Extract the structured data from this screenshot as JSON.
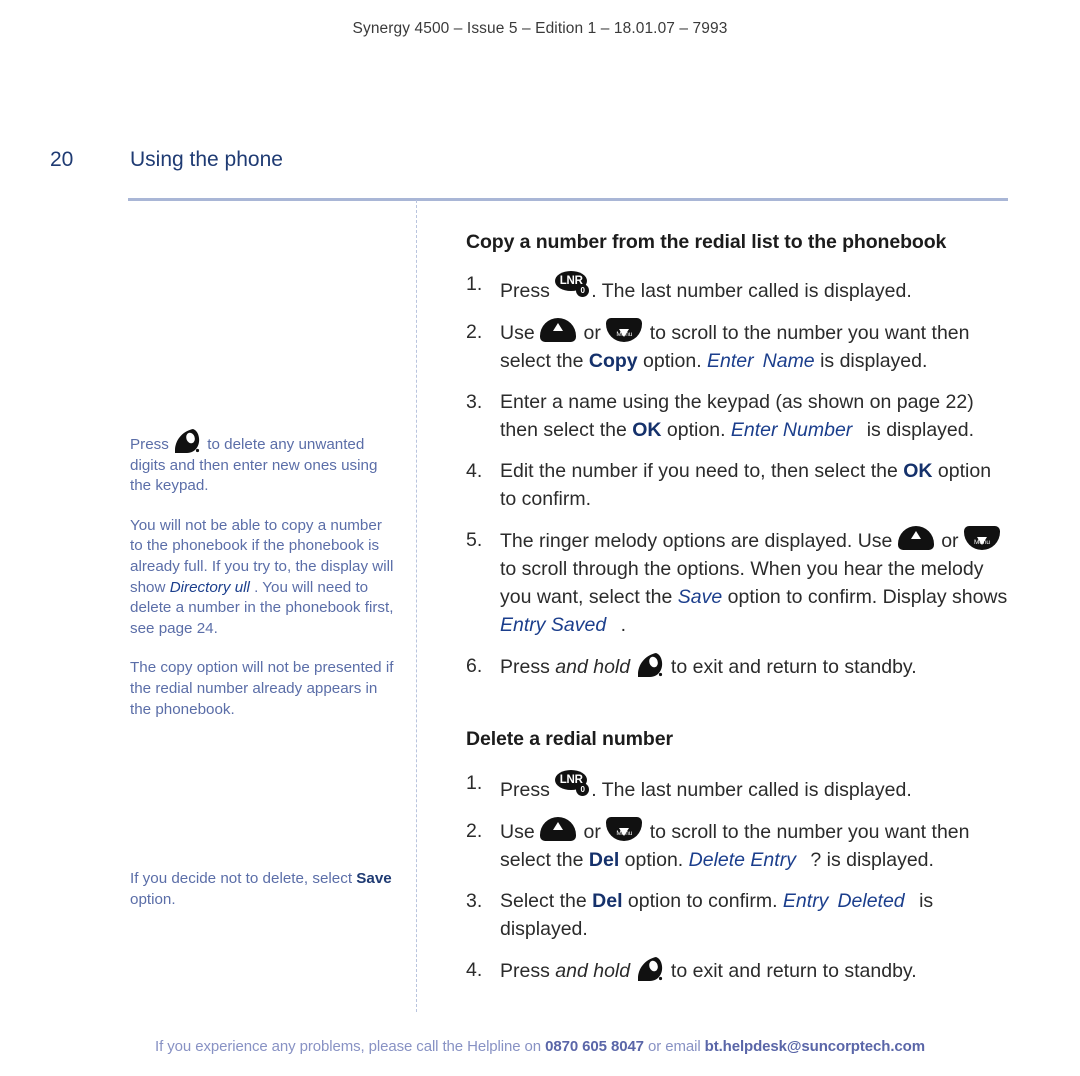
{
  "header": {
    "running_text": "Synergy 4500 – Issue 5 –  Edition 1 – 18.01.07 – 7993"
  },
  "page": {
    "number": "20",
    "title": "Using the phone"
  },
  "colors": {
    "title_blue": "#1f3b73",
    "note_blue": "#5b6ea8",
    "display_blue": "#1b3e8c",
    "option_blue": "#15316b",
    "rule_blue": "#a9b6d6",
    "footer_blue": "#8892c4",
    "key_black": "#111111"
  },
  "margin_notes": [
    {
      "id": "note-delete-digits",
      "parts": [
        {
          "t": "text",
          "v": "Press "
        },
        {
          "t": "icon",
          "v": "handset-icon"
        },
        {
          "t": "text",
          "v": " to delete any unwanted digits and then enter new ones using the keypad."
        }
      ]
    },
    {
      "id": "note-phonebook-full",
      "parts": [
        {
          "t": "text",
          "v": "You will not be able to copy a number to the phonebook if the phonebook is already full. If you try to, the display will show "
        },
        {
          "t": "display",
          "v": "Directory"
        },
        {
          "t": "text",
          "v": " "
        },
        {
          "t": "display",
          "v": "ull"
        },
        {
          "t": "text",
          "v": " . You will need to delete a number in the phonebook first, see page 24."
        }
      ]
    },
    {
      "id": "note-copy-not-presented",
      "parts": [
        {
          "t": "text",
          "v": "The copy option will not be presented if the redial number already appears in the phonebook."
        }
      ]
    },
    {
      "id": "note-decide-not-delete",
      "parts": [
        {
          "t": "text",
          "v": "If you decide not to delete, select "
        },
        {
          "t": "bold",
          "v": "Save"
        },
        {
          "t": "text",
          "v": " option."
        }
      ]
    }
  ],
  "sections": [
    {
      "id": "copy-number-section",
      "heading": "Copy a number from the redial list to the phonebook",
      "steps": [
        {
          "num": "1.",
          "parts": [
            {
              "t": "text",
              "v": "Press "
            },
            {
              "t": "icon",
              "v": "lnr-key-icon"
            },
            {
              "t": "text",
              "v": ". The last number called is displayed."
            }
          ]
        },
        {
          "num": "2.",
          "parts": [
            {
              "t": "text",
              "v": "Use "
            },
            {
              "t": "icon",
              "v": "nav-up-key-icon"
            },
            {
              "t": "text",
              "v": " or "
            },
            {
              "t": "icon",
              "v": "nav-down-key-icon"
            },
            {
              "t": "text",
              "v": " to scroll to the number you want then select the "
            },
            {
              "t": "option",
              "v": "Copy"
            },
            {
              "t": "text",
              "v": " option. "
            },
            {
              "t": "display",
              "v": "Enter"
            },
            {
              "t": "gap",
              "v": ""
            },
            {
              "t": "display",
              "v": "Name"
            },
            {
              "t": "text",
              "v": " is displayed."
            }
          ]
        },
        {
          "num": "3.",
          "parts": [
            {
              "t": "text",
              "v": "Enter a name using the keypad (as shown on page 22) then select the "
            },
            {
              "t": "option",
              "v": "OK"
            },
            {
              "t": "text",
              "v": " option. "
            },
            {
              "t": "display",
              "v": "Enter Number"
            },
            {
              "t": "gap",
              "v": ""
            },
            {
              "t": "text",
              "v": " is displayed."
            }
          ]
        },
        {
          "num": "4.",
          "parts": [
            {
              "t": "text",
              "v": "Edit the number if you need to, then select the "
            },
            {
              "t": "option",
              "v": "OK"
            },
            {
              "t": "text",
              "v": " option to confirm."
            }
          ]
        },
        {
          "num": "5.",
          "parts": [
            {
              "t": "text",
              "v": "The ringer melody options are displayed. Use "
            },
            {
              "t": "icon",
              "v": "nav-up-key-icon"
            },
            {
              "t": "text",
              "v": " or "
            },
            {
              "t": "icon",
              "v": "nav-down-key-icon"
            },
            {
              "t": "text",
              "v": " to scroll through the options. When you hear the melody you want, select the "
            },
            {
              "t": "display",
              "v": "Save"
            },
            {
              "t": "text",
              "v": "  option to confirm. Display shows "
            },
            {
              "t": "display",
              "v": "Entry Saved"
            },
            {
              "t": "gap",
              "v": ""
            },
            {
              "t": "text",
              "v": " ."
            }
          ]
        },
        {
          "num": "6.",
          "parts": [
            {
              "t": "text",
              "v": "Press "
            },
            {
              "t": "italic",
              "v": "and hold"
            },
            {
              "t": "text",
              "v": " "
            },
            {
              "t": "icon",
              "v": "handset-icon"
            },
            {
              "t": "text",
              "v": " to exit and return to standby."
            }
          ]
        }
      ]
    },
    {
      "id": "delete-redial-section",
      "heading": "Delete a redial number",
      "steps": [
        {
          "num": "1.",
          "parts": [
            {
              "t": "text",
              "v": "Press "
            },
            {
              "t": "icon",
              "v": "lnr-key-icon"
            },
            {
              "t": "text",
              "v": ". The last number called is displayed."
            }
          ]
        },
        {
          "num": "2.",
          "parts": [
            {
              "t": "text",
              "v": "Use "
            },
            {
              "t": "icon",
              "v": "nav-up-key-icon"
            },
            {
              "t": "text",
              "v": " or "
            },
            {
              "t": "icon",
              "v": "nav-down-key-icon"
            },
            {
              "t": "text",
              "v": " to scroll to the number you want then select the "
            },
            {
              "t": "option",
              "v": "Del"
            },
            {
              "t": "text",
              "v": " option. "
            },
            {
              "t": "display",
              "v": "Delete Entry"
            },
            {
              "t": "gap",
              "v": ""
            },
            {
              "t": "text",
              "v": " ? is displayed."
            }
          ]
        },
        {
          "num": "3.",
          "parts": [
            {
              "t": "text",
              "v": "Select the "
            },
            {
              "t": "option",
              "v": "Del"
            },
            {
              "t": "text",
              "v": " option to confirm. "
            },
            {
              "t": "display",
              "v": "Entry"
            },
            {
              "t": "gap",
              "v": ""
            },
            {
              "t": "display",
              "v": "Deleted"
            },
            {
              "t": "gap",
              "v": ""
            },
            {
              "t": "text",
              "v": " is displayed."
            }
          ]
        },
        {
          "num": "4.",
          "parts": [
            {
              "t": "text",
              "v": "Press "
            },
            {
              "t": "italic",
              "v": "and hold"
            },
            {
              "t": "text",
              "v": " "
            },
            {
              "t": "icon",
              "v": "handset-icon"
            },
            {
              "t": "text",
              "v": " to exit and return to standby."
            }
          ]
        }
      ]
    }
  ],
  "keys": {
    "lnr_label": "LNR",
    "lnr_sub_label": "0",
    "menu_label": "Menu"
  },
  "footer": {
    "parts": [
      {
        "t": "text",
        "v": "If you experience any problems, please call the Helpline on "
      },
      {
        "t": "bold",
        "v": "0870 605 8047"
      },
      {
        "t": "text",
        "v": " or email "
      },
      {
        "t": "bold",
        "v": "bt.helpdesk@suncorptech.com"
      }
    ]
  }
}
